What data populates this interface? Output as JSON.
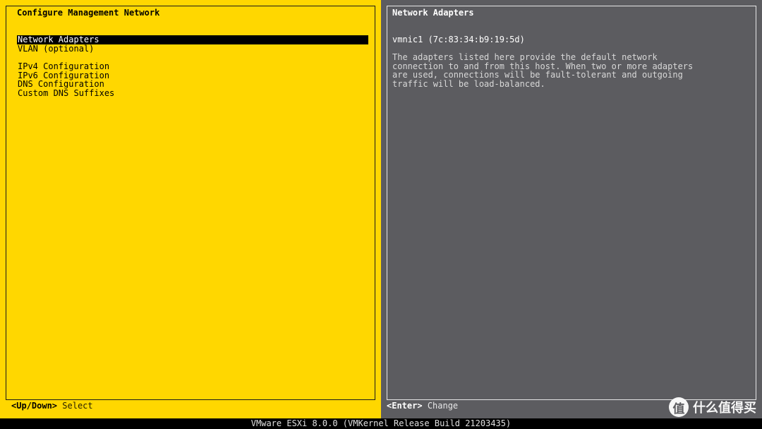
{
  "left_panel": {
    "title": "Configure Management Network",
    "menu": [
      {
        "label": "Network Adapters",
        "selected": true
      },
      {
        "label": "VLAN (optional)"
      },
      {
        "label": ""
      },
      {
        "label": "IPv4 Configuration"
      },
      {
        "label": "IPv6 Configuration"
      },
      {
        "label": "DNS Configuration"
      },
      {
        "label": "Custom DNS Suffixes"
      }
    ],
    "hint_key": "<Up/Down>",
    "hint_action": "Select"
  },
  "right_panel": {
    "title": "Network Adapters",
    "adapter": "vmnic1 (7c:83:34:b9:19:5d)",
    "description": [
      "The adapters listed here provide the default network",
      "connection to and from this host. When two or more adapters",
      "are used, connections will be fault-tolerant and outgoing",
      "traffic will be load-balanced."
    ],
    "hint_key": "<Enter>",
    "hint_action": "Change"
  },
  "footer": "VMware ESXi 8.0.0 (VMKernel Release Build 21203435)",
  "watermark": {
    "glyph": "值",
    "text": "什么值得买"
  },
  "colors": {
    "left_bg": "#FFD700",
    "right_bg": "#5C5C60",
    "selection_bg": "#000000"
  }
}
